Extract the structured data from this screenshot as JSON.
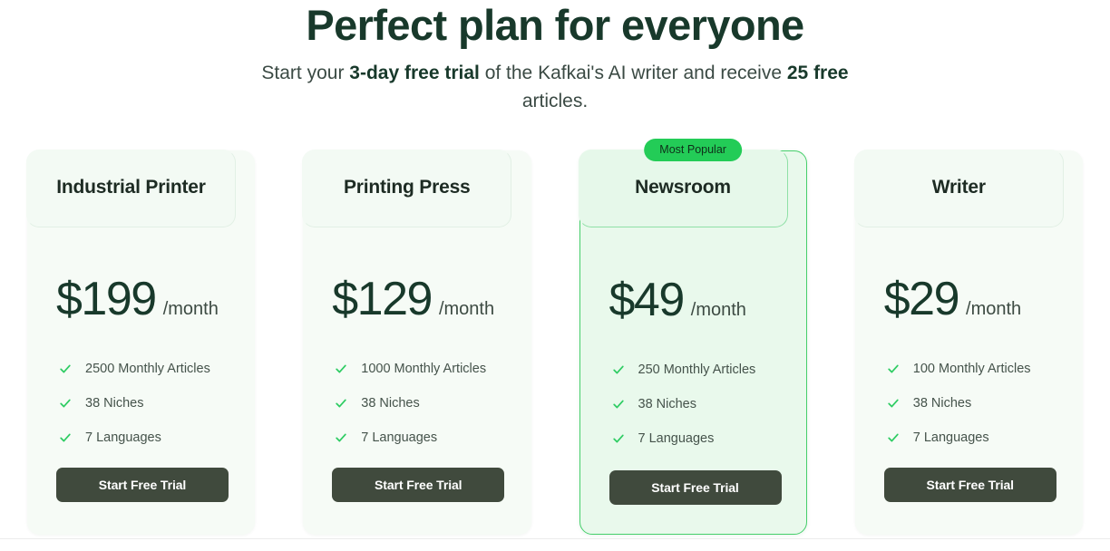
{
  "hero": {
    "title": "Perfect plan for everyone",
    "subtitle_part1": "Start your ",
    "subtitle_bold1": "3-day free trial",
    "subtitle_part2": " of the Kafkai's AI writer and receive ",
    "subtitle_bold2": "25 free",
    "subtitle_part3": " articles."
  },
  "colors": {
    "heading": "#18392b",
    "card_bg": "#f6fbf6",
    "featured_bg": "#e9f9ec",
    "featured_border": "#46cf6b",
    "badge_bg": "#23cc57",
    "check": "#2ecc63",
    "button_bg": "#404a3d",
    "page_bg": "#ffffff"
  },
  "cards": [
    {
      "name": "Industrial Printer",
      "price": "$199",
      "period": "/month",
      "featured": false,
      "badge": "",
      "features": [
        "2500 Monthly Articles",
        "38 Niches",
        "7 Languages"
      ],
      "cta_label": "Start Free Trial"
    },
    {
      "name": "Printing Press",
      "price": "$129",
      "period": "/month",
      "featured": false,
      "badge": "",
      "features": [
        "1000 Monthly Articles",
        "38 Niches",
        "7 Languages"
      ],
      "cta_label": "Start Free Trial"
    },
    {
      "name": "Newsroom",
      "price": "$49",
      "period": "/month",
      "featured": true,
      "badge": "Most Popular",
      "features": [
        "250 Monthly Articles",
        "38 Niches",
        "7 Languages"
      ],
      "cta_label": "Start Free Trial"
    },
    {
      "name": "Writer",
      "price": "$29",
      "period": "/month",
      "featured": false,
      "badge": "",
      "features": [
        "100 Monthly Articles",
        "38 Niches",
        "7 Languages"
      ],
      "cta_label": "Start Free Trial"
    }
  ],
  "icons": {
    "check": "check-icon"
  }
}
